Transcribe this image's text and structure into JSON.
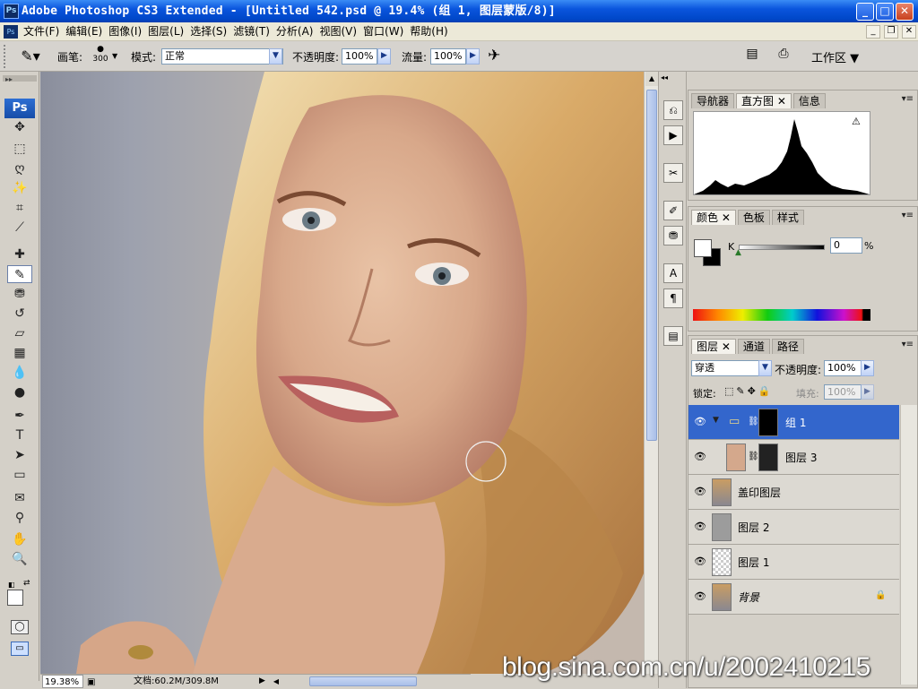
{
  "window": {
    "title": "Adobe Photoshop CS3 Extended - [Untitled 542.psd @ 19.4% (组 1, 图层蒙版/8)]",
    "app_icon": "Ps",
    "buttons": {
      "minimize": "_",
      "maximize": "□",
      "close": "✕"
    }
  },
  "menubar": {
    "doc_icon": "Ps",
    "items": [
      "文件(F)",
      "编辑(E)",
      "图像(I)",
      "图层(L)",
      "选择(S)",
      "滤镜(T)",
      "分析(A)",
      "视图(V)",
      "窗口(W)",
      "帮助(H)"
    ],
    "doc_buttons": {
      "minimize": "_",
      "restore": "❐",
      "close": "✕"
    }
  },
  "options": {
    "brush_label": "画笔:",
    "brush_size": "300",
    "mode_label": "模式:",
    "mode_value": "正常",
    "opacity_label": "不透明度:",
    "opacity_value": "100%",
    "flow_label": "流量:",
    "flow_value": "100%",
    "workspace_label": "工作区"
  },
  "toolbox": {
    "logo": "Ps",
    "tools": [
      {
        "name": "move-tool",
        "glyph": "✥"
      },
      {
        "name": "marquee-tool",
        "glyph": "⬚"
      },
      {
        "name": "lasso-tool",
        "glyph": "ღ"
      },
      {
        "name": "magic-wand-tool",
        "glyph": "✨"
      },
      {
        "name": "crop-tool",
        "glyph": "⌗"
      },
      {
        "name": "slice-tool",
        "glyph": "⟋"
      },
      {
        "name": "healing-brush-tool",
        "glyph": "✚"
      },
      {
        "name": "brush-tool",
        "glyph": "✎"
      },
      {
        "name": "clone-stamp-tool",
        "glyph": "⛃"
      },
      {
        "name": "history-brush-tool",
        "glyph": "↺"
      },
      {
        "name": "eraser-tool",
        "glyph": "▱"
      },
      {
        "name": "gradient-tool",
        "glyph": "▦"
      },
      {
        "name": "blur-tool",
        "glyph": "💧"
      },
      {
        "name": "dodge-tool",
        "glyph": "●"
      },
      {
        "name": "pen-tool",
        "glyph": "✒"
      },
      {
        "name": "type-tool",
        "glyph": "T"
      },
      {
        "name": "path-selection-tool",
        "glyph": "➤"
      },
      {
        "name": "shape-tool",
        "glyph": "▭"
      },
      {
        "name": "notes-tool",
        "glyph": "✉"
      },
      {
        "name": "eyedropper-tool",
        "glyph": "⚲"
      },
      {
        "name": "hand-tool",
        "glyph": "✋"
      },
      {
        "name": "zoom-tool",
        "glyph": "🔍"
      }
    ]
  },
  "status": {
    "zoom": "19.38%",
    "doc_info": "文档:60.2M/309.8M"
  },
  "panels": {
    "navigator": {
      "tabs": [
        "导航器",
        "直方图",
        "信息"
      ],
      "active": 1
    },
    "color": {
      "tabs": [
        "颜色",
        "色板",
        "样式"
      ],
      "active": 0,
      "channel_label": "K",
      "value": "0",
      "unit": "%"
    },
    "layers": {
      "tabs": [
        "图层",
        "通道",
        "路径"
      ],
      "active": 0,
      "blend_mode": "穿透",
      "opacity_label": "不透明度:",
      "opacity_value": "100%",
      "lock_label": "锁定:",
      "fill_label": "填充:",
      "fill_value": "100%",
      "rows": [
        {
          "name": "组 1",
          "selected": true
        },
        {
          "name": "图层 3",
          "selected": false
        },
        {
          "name": "盖印图层",
          "selected": false
        },
        {
          "name": "图层 2",
          "selected": false
        },
        {
          "name": "图层 1",
          "selected": false
        },
        {
          "name": "背景",
          "selected": false
        }
      ]
    }
  },
  "watermark": "blog.sina.com.cn/u/2002410215",
  "colors": {
    "accent": "#3366cc",
    "titlebar": "#0a55dd"
  }
}
